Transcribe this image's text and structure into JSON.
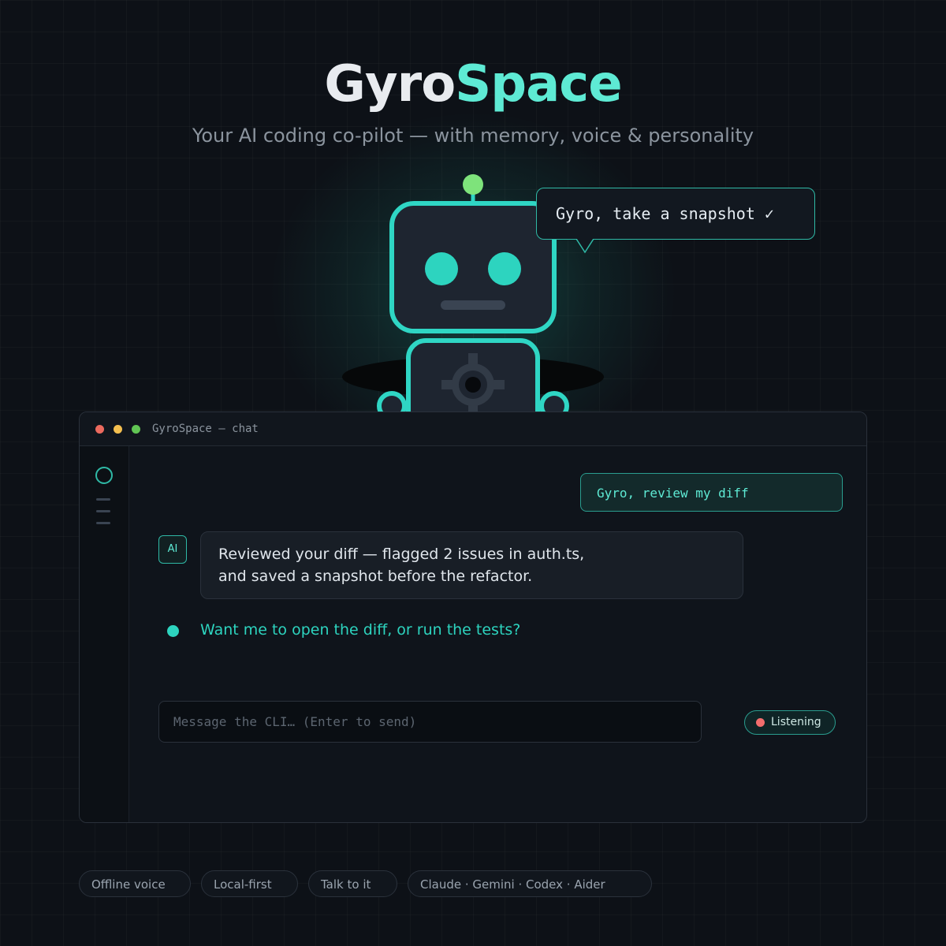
{
  "hero": {
    "title_part1": "Gyro",
    "title_part2": "Space",
    "subtitle": "Your AI coding co-pilot — with memory, voice & personality"
  },
  "mascot": {
    "speech_bubble": "Gyro, take a snapshot ✓"
  },
  "window": {
    "title": "GyroSpace — chat",
    "traffic_lights": [
      "#ec6a5e",
      "#f4bf4f",
      "#61c554"
    ],
    "chat": {
      "user_message": "Gyro, review my diff",
      "ai_avatar": "AI",
      "ai_message_line1": "Reviewed your diff — flagged 2 issues in auth.ts,",
      "ai_message_line2": "and saved a snapshot before the refactor.",
      "followup": "Want me to open the diff, or run the tests?"
    },
    "input": {
      "placeholder": "Message the CLI… (Enter to send)",
      "value": ""
    },
    "status": {
      "label": "Listening"
    }
  },
  "features": [
    "Offline voice",
    "Local-first",
    "Talk to it",
    "Claude · Gemini · Codex · Aider"
  ],
  "colors": {
    "background": "#0d1117",
    "accent": "#5eead4",
    "accent_strong": "#2dd4bf",
    "recording": "#f26d6d"
  }
}
